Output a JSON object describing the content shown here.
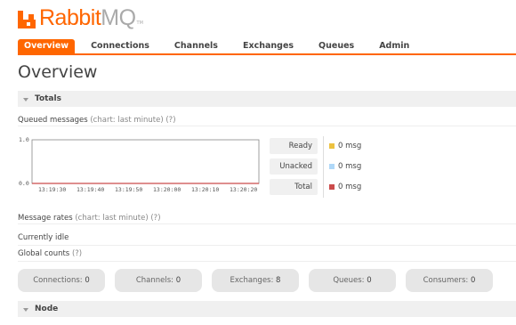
{
  "brand": {
    "name_part1": "Rabbit",
    "name_part2": "MQ",
    "tm": "TM",
    "color": "#ff6600"
  },
  "nav": {
    "tabs": [
      {
        "label": "Overview",
        "active": true
      },
      {
        "label": "Connections",
        "active": false
      },
      {
        "label": "Channels",
        "active": false
      },
      {
        "label": "Exchanges",
        "active": false
      },
      {
        "label": "Queues",
        "active": false
      },
      {
        "label": "Admin",
        "active": false
      }
    ]
  },
  "page": {
    "title": "Overview"
  },
  "totals": {
    "heading": "Totals",
    "queued_messages": {
      "label": "Queued messages",
      "note": "(chart: last minute) (?)"
    },
    "chart": {
      "y_max_label": "1.0",
      "y_min_label": "0.0",
      "x_ticks": [
        "13:19:30",
        "13:19:40",
        "13:19:50",
        "13:20:00",
        "13:20:10",
        "13:20:20"
      ]
    },
    "legend": [
      {
        "label": "Ready",
        "value": "0 msg",
        "color": "#edc240"
      },
      {
        "label": "Unacked",
        "value": "0 msg",
        "color": "#afd8f8"
      },
      {
        "label": "Total",
        "value": "0 msg",
        "color": "#cb4b4b"
      }
    ],
    "message_rates": {
      "label": "Message rates",
      "note": "(chart: last minute) (?)"
    },
    "idle_text": "Currently idle",
    "global_counts": {
      "label": "Global counts",
      "note": "(?)"
    },
    "counts": [
      {
        "label": "Connections:",
        "value": "0"
      },
      {
        "label": "Channels:",
        "value": "0"
      },
      {
        "label": "Exchanges:",
        "value": "8"
      },
      {
        "label": "Queues:",
        "value": "0"
      },
      {
        "label": "Consumers:",
        "value": "0"
      }
    ]
  },
  "node": {
    "heading": "Node"
  }
}
